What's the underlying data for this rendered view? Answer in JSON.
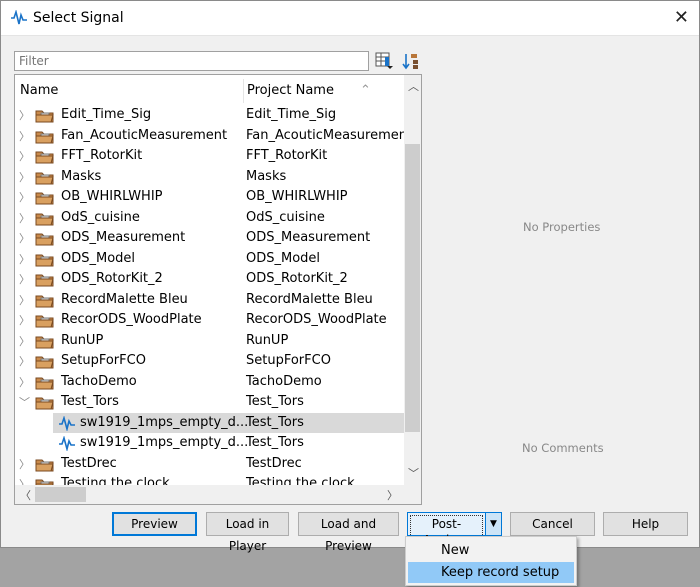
{
  "window": {
    "title": "Select Signal",
    "close": "✕"
  },
  "filter": {
    "placeholder": "Filter",
    "value": ""
  },
  "tree": {
    "columns": [
      "Name",
      "Project Name"
    ],
    "rows": [
      {
        "name": "Edit_Time_Sig",
        "project": "Edit_Time_Sig",
        "type": "project",
        "expanded": false
      },
      {
        "name": "Fan_AcouticMeasurement",
        "project": "Fan_AcouticMeasurement",
        "type": "project",
        "expanded": false
      },
      {
        "name": "FFT_RotorKit",
        "project": "FFT_RotorKit",
        "type": "project",
        "expanded": false
      },
      {
        "name": "Masks",
        "project": "Masks",
        "type": "project",
        "expanded": false
      },
      {
        "name": "OB_WHIRLWHIP",
        "project": "OB_WHIRLWHIP",
        "type": "project",
        "expanded": false
      },
      {
        "name": "OdS_cuisine",
        "project": "OdS_cuisine",
        "type": "project",
        "expanded": false
      },
      {
        "name": "ODS_Measurement",
        "project": "ODS_Measurement",
        "type": "project",
        "expanded": false
      },
      {
        "name": "ODS_Model",
        "project": "ODS_Model",
        "type": "project",
        "expanded": false
      },
      {
        "name": "ODS_RotorKit_2",
        "project": "ODS_RotorKit_2",
        "type": "project",
        "expanded": false
      },
      {
        "name": "RecordMalette Bleu",
        "project": "RecordMalette Bleu",
        "type": "project",
        "expanded": false
      },
      {
        "name": "RecorODS_WoodPlate",
        "project": "RecorODS_WoodPlate",
        "type": "project",
        "expanded": false
      },
      {
        "name": "RunUP",
        "project": "RunUP",
        "type": "project",
        "expanded": false
      },
      {
        "name": "SetupForFCO",
        "project": "SetupForFCO",
        "type": "project",
        "expanded": false
      },
      {
        "name": "TachoDemo",
        "project": "TachoDemo",
        "type": "project",
        "expanded": false
      },
      {
        "name": "Test_Tors",
        "project": "Test_Tors",
        "type": "project",
        "expanded": true
      },
      {
        "name": "sw1919_1mps_empty_d...",
        "project": "Test_Tors",
        "type": "signal",
        "selected": true
      },
      {
        "name": "sw1919_1mps_empty_d...",
        "project": "Test_Tors",
        "type": "signal"
      },
      {
        "name": "TestDrec",
        "project": "TestDrec",
        "type": "project",
        "expanded": false
      },
      {
        "name": "Testing the clock",
        "project": "Testing the clock",
        "type": "project",
        "expanded": false
      }
    ]
  },
  "panels": {
    "properties": "No Properties",
    "comments": "No Comments"
  },
  "buttons": {
    "preview": "Preview",
    "load_player": "Load in Player",
    "load_preview": "Load and Preview",
    "post_analyze": "Post-Analyze",
    "cancel": "Cancel",
    "help": "Help"
  },
  "menu": {
    "items": [
      "New",
      "Keep record setup"
    ],
    "highlighted": "Keep record setup"
  },
  "colors": {
    "accent": "#0078d7",
    "highlight": "#91c9f7",
    "signal_icon": "#1a73c8",
    "folder": "#b8763a"
  }
}
